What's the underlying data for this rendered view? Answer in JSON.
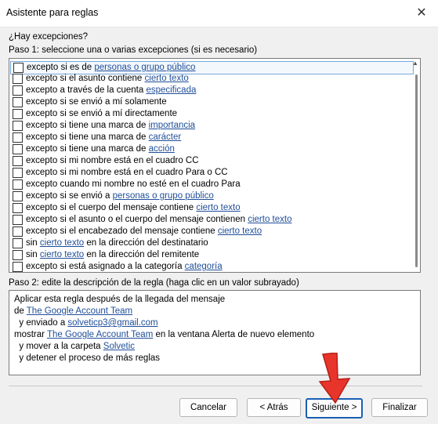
{
  "window": {
    "title": "Asistente para reglas",
    "close_icon": "close-icon"
  },
  "question": "¿Hay excepciones?",
  "step1": {
    "label": "Paso 1: seleccione una o varias excepciones (si es necesario)",
    "items": [
      {
        "checked": false,
        "selected": true,
        "parts": [
          {
            "t": "excepto si es de "
          },
          {
            "t": "personas o grupo público",
            "link": true
          }
        ]
      },
      {
        "checked": false,
        "parts": [
          {
            "t": "excepto si el asunto contiene "
          },
          {
            "t": "cierto texto",
            "link": true
          }
        ]
      },
      {
        "checked": false,
        "parts": [
          {
            "t": "excepto a través de la cuenta "
          },
          {
            "t": "especificada",
            "link": true
          }
        ]
      },
      {
        "checked": false,
        "parts": [
          {
            "t": "excepto si se envió a mí solamente"
          }
        ]
      },
      {
        "checked": false,
        "parts": [
          {
            "t": "excepto si se envió a mí directamente"
          }
        ]
      },
      {
        "checked": false,
        "parts": [
          {
            "t": "excepto si tiene una marca de "
          },
          {
            "t": "importancia",
            "link": true
          }
        ]
      },
      {
        "checked": false,
        "parts": [
          {
            "t": "excepto si tiene una marca de "
          },
          {
            "t": "carácter",
            "link": true
          }
        ]
      },
      {
        "checked": false,
        "parts": [
          {
            "t": "excepto si tiene una marca de "
          },
          {
            "t": "acción",
            "link": true
          }
        ]
      },
      {
        "checked": false,
        "parts": [
          {
            "t": "excepto si mi nombre está en el cuadro CC"
          }
        ]
      },
      {
        "checked": false,
        "parts": [
          {
            "t": "excepto si mi nombre está en el cuadro Para o CC"
          }
        ]
      },
      {
        "checked": false,
        "parts": [
          {
            "t": "excepto cuando mi nombre no esté en el cuadro Para"
          }
        ]
      },
      {
        "checked": false,
        "parts": [
          {
            "t": "excepto si se envió a "
          },
          {
            "t": "personas o grupo público",
            "link": true
          }
        ]
      },
      {
        "checked": false,
        "parts": [
          {
            "t": "excepto si el cuerpo del mensaje contiene "
          },
          {
            "t": "cierto texto",
            "link": true
          }
        ]
      },
      {
        "checked": false,
        "parts": [
          {
            "t": "excepto si el asunto o el cuerpo del mensaje contienen "
          },
          {
            "t": "cierto texto",
            "link": true
          }
        ]
      },
      {
        "checked": false,
        "parts": [
          {
            "t": "excepto si el encabezado del mensaje contiene "
          },
          {
            "t": "cierto texto",
            "link": true
          }
        ]
      },
      {
        "checked": false,
        "parts": [
          {
            "t": "sin "
          },
          {
            "t": "cierto texto",
            "link": true
          },
          {
            "t": " en la dirección del destinatario"
          }
        ]
      },
      {
        "checked": false,
        "parts": [
          {
            "t": "sin "
          },
          {
            "t": "cierto texto",
            "link": true
          },
          {
            "t": " en la dirección del remitente"
          }
        ]
      },
      {
        "checked": false,
        "parts": [
          {
            "t": "excepto si está asignado a la categoría "
          },
          {
            "t": "categoría",
            "link": true
          }
        ]
      }
    ]
  },
  "step2": {
    "label": "Paso 2: edite la descripción de la regla (haga clic en un valor subrayado)",
    "lines": [
      {
        "parts": [
          {
            "t": "Aplicar esta regla después de la llegada del mensaje"
          }
        ]
      },
      {
        "parts": [
          {
            "t": "de "
          },
          {
            "t": "The Google Account Team",
            "link": true
          }
        ]
      },
      {
        "parts": [
          {
            "t": "  y enviado a "
          },
          {
            "t": "solveticp3@gmail.com",
            "link": true
          }
        ]
      },
      {
        "parts": [
          {
            "t": "mostrar "
          },
          {
            "t": "The Google Account Team",
            "link": true
          },
          {
            "t": " en la ventana Alerta de nuevo elemento"
          }
        ]
      },
      {
        "parts": [
          {
            "t": "  y mover a la carpeta "
          },
          {
            "t": "Solvetic",
            "link": true
          }
        ]
      },
      {
        "parts": [
          {
            "t": "  y detener el proceso de más reglas"
          }
        ]
      }
    ]
  },
  "buttons": {
    "cancel": "Cancelar",
    "back": "< Atrás",
    "next": "Siguiente >",
    "finish": "Finalizar"
  },
  "colors": {
    "link": "#1f4e99",
    "primary_border": "#1a5fb4",
    "arrow": "#e8352b"
  }
}
